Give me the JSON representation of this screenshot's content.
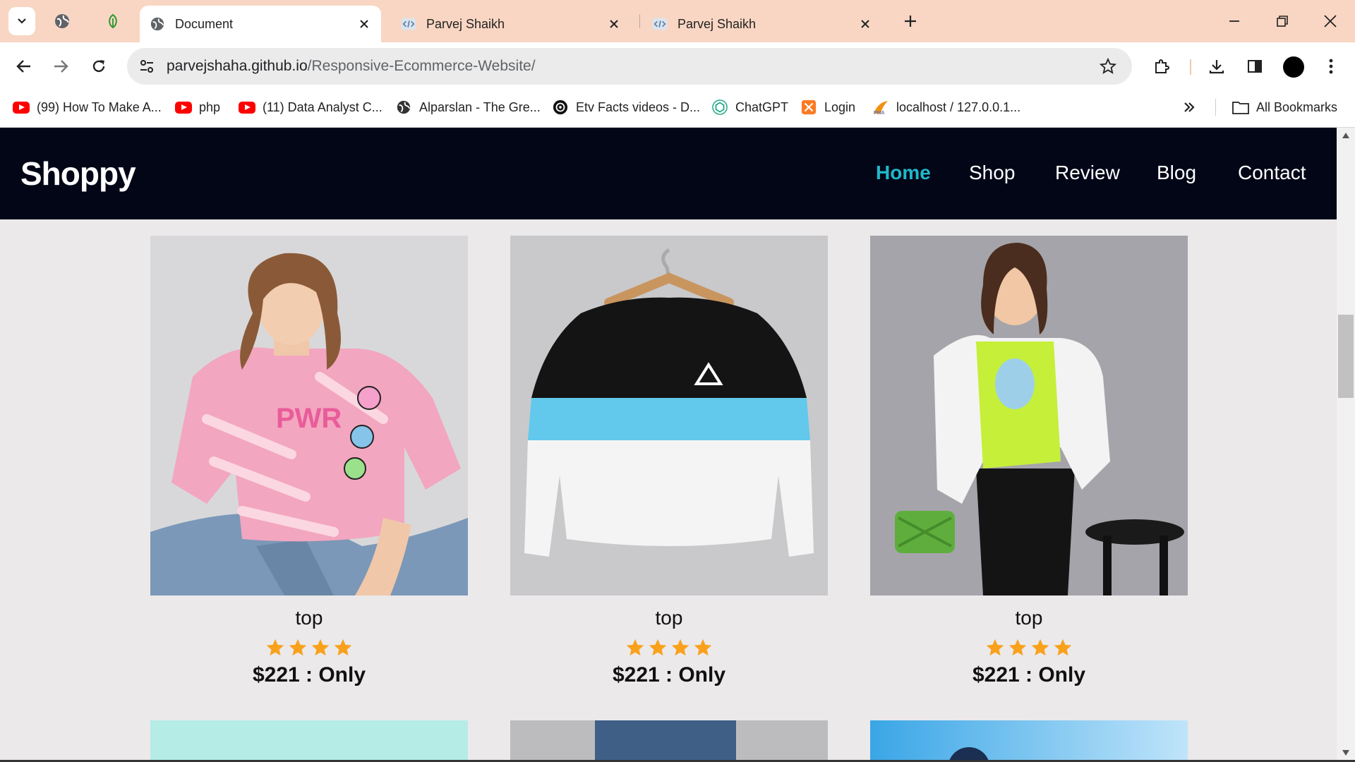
{
  "browser": {
    "tabs": [
      {
        "label": "Document",
        "active": true
      },
      {
        "label": "Parvej Shaikh",
        "active": false
      },
      {
        "label": "Parvej Shaikh",
        "active": false
      }
    ],
    "url_domain": "parvejshaha.github.io",
    "url_path": "/Responsive-Ecommerce-Website/",
    "bookmarks": [
      {
        "label": "(99) How To Make A...",
        "icon": "youtube-icon"
      },
      {
        "label": "php",
        "icon": "youtube-icon"
      },
      {
        "label": "(11) Data Analyst C...",
        "icon": "youtube-icon"
      },
      {
        "label": "Alparslan - The Gre...",
        "icon": "globe-icon"
      },
      {
        "label": "Etv Facts videos - D...",
        "icon": "etv-icon"
      },
      {
        "label": "ChatGPT",
        "icon": "chatgpt-icon"
      },
      {
        "label": "Login",
        "icon": "xampp-icon"
      },
      {
        "label": "localhost / 127.0.0.1...",
        "icon": "phpmyadmin-icon"
      }
    ],
    "all_bookmarks_label": "All Bookmarks",
    "colors": {
      "tabstrip": "#f9d6c3",
      "toolbar": "#ffffff"
    }
  },
  "site": {
    "logo": "Shoppy",
    "nav": [
      {
        "label": "Home",
        "active": true
      },
      {
        "label": "Shop",
        "active": false
      },
      {
        "label": "Review",
        "active": false
      },
      {
        "label": "Blog",
        "active": false
      },
      {
        "label": "Contact",
        "active": false
      }
    ],
    "accent": "#20b8c9",
    "header_bg": "#020617"
  },
  "products": [
    {
      "title": "top",
      "rating": 4,
      "price": "$221 : Only",
      "image": "woman-pink-tie-dye-tshirt"
    },
    {
      "title": "top",
      "rating": 4,
      "price": "$221 : Only",
      "image": "black-blue-white-sweatshirt-on-hanger"
    },
    {
      "title": "top",
      "rating": 4,
      "price": "$221 : Only",
      "image": "woman-lime-tshirt-white-denim-jacket"
    }
  ],
  "star_color": "#f9a11b"
}
